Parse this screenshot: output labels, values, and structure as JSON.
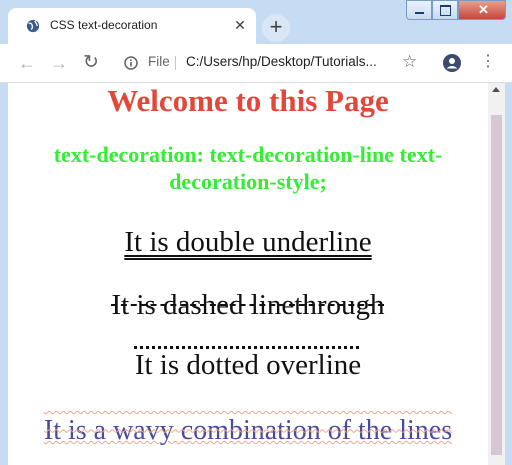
{
  "tab": {
    "title": "CSS text-decoration",
    "close_icon": "close-icon",
    "new_tab_label": "+"
  },
  "toolbar": {
    "file_label": "File",
    "url": "C:/Users/hp/Desktop/Tutorials..."
  },
  "page": {
    "heading": "Welcome to this Page",
    "subheading": "text-decoration: text-decoration-line text-decoration-style;",
    "lines": [
      "It is double underline",
      "It is dashed linethrough",
      "It is dotted overline",
      "It is a wavy combination of the lines"
    ]
  },
  "colors": {
    "heading": "#e2483a",
    "subheading": "#33ee33",
    "wavy_text": "#4a4aa0",
    "wavy_decoration": "#f0a48c"
  }
}
